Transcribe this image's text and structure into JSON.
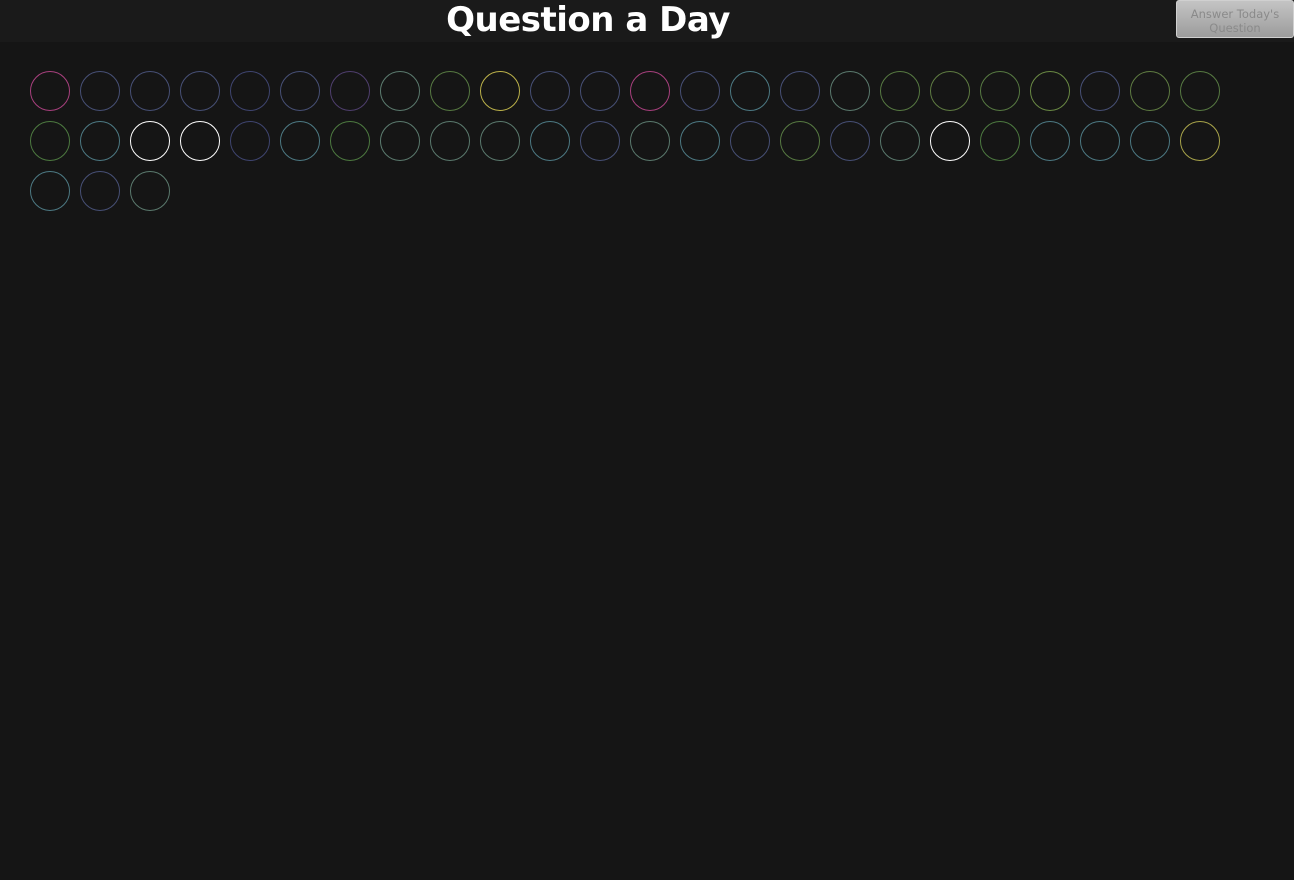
{
  "header": {
    "title": "Question a Day",
    "answer_button_label": "Answer Today's Question"
  },
  "colors": {
    "background": "#151515",
    "header_background": "#1a1a1a",
    "title_text": "#ffffff",
    "button_text": "#8a8a8a"
  },
  "days": {
    "count": 51,
    "ring_colors": [
      "#a8407e",
      "#475076",
      "#475076",
      "#475076",
      "#3f4570",
      "#475076",
      "#4f3f6e",
      "#5b7a6e",
      "#577a42",
      "#bcb24a",
      "#475076",
      "#475076",
      "#a8407e",
      "#475076",
      "#4d7a84",
      "#475076",
      "#5b7a6e",
      "#577a42",
      "#5f7c42",
      "#577a42",
      "#6a8a44",
      "#475076",
      "#5f7c42",
      "#577a42",
      "#4d7a40",
      "#4d7a84",
      "#ffffff",
      "#ffffff",
      "#3f4570",
      "#4d7a84",
      "#4d7a40",
      "#5b7a6e",
      "#5b7a6e",
      "#5b7a6e",
      "#4d7a84",
      "#475076",
      "#5b7a6e",
      "#4d7a84",
      "#475076",
      "#577a42",
      "#475076",
      "#5b7a6e",
      "#ffffff",
      "#4d7a40",
      "#4d7a84",
      "#4d7a84",
      "#4d7a84",
      "#a8a44a",
      "#4d7a84",
      "#475076",
      "#5b7a6e"
    ]
  }
}
